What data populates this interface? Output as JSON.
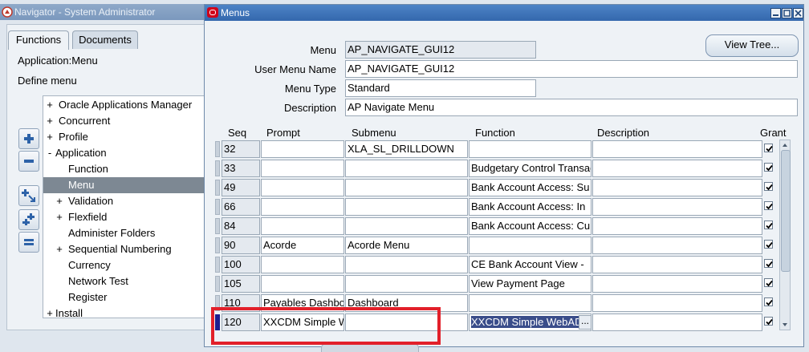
{
  "navigator": {
    "title": "Navigator - System Administrator",
    "tabs": [
      {
        "label": "Functions"
      },
      {
        "label": "Documents"
      }
    ],
    "application_label": "Application:Menu",
    "define_label": "Define menu",
    "tree": [
      {
        "expander": "+",
        "label": "Oracle Applications Manager"
      },
      {
        "expander": "+",
        "label": "Concurrent"
      },
      {
        "expander": "+",
        "label": "Profile"
      },
      {
        "expander": "-",
        "label": "Application"
      },
      {
        "expander": "",
        "label": "Function"
      },
      {
        "expander": "",
        "label": "Menu"
      },
      {
        "expander": "+",
        "label": "Validation"
      },
      {
        "expander": "+",
        "label": "Flexfield"
      },
      {
        "expander": "",
        "label": "Administer Folders"
      },
      {
        "expander": "+",
        "label": "Sequential Numbering"
      },
      {
        "expander": "",
        "label": "Currency"
      },
      {
        "expander": "",
        "label": "Network Test"
      },
      {
        "expander": "",
        "label": "Register"
      },
      {
        "expander": "+",
        "label": "Install"
      }
    ]
  },
  "menus_window": {
    "title": "Menus",
    "view_tree_label": "View Tree...",
    "fields": {
      "menu": {
        "label": "Menu",
        "value": "AP_NAVIGATE_GUI12"
      },
      "user_menu_name": {
        "label": "User Menu Name",
        "value": "AP_NAVIGATE_GUI12"
      },
      "menu_type": {
        "label": "Menu Type",
        "value": "Standard"
      },
      "description": {
        "label": "Description",
        "value": "AP Navigate Menu"
      }
    },
    "columns": {
      "seq": "Seq",
      "prompt": "Prompt",
      "submenu": "Submenu",
      "function": "Function",
      "description": "Description",
      "grant": "Grant"
    },
    "rows": [
      {
        "seq": "32",
        "prompt": "",
        "submenu": "XLA_SL_DRILLDOWN",
        "function": "",
        "description": "",
        "grant": true
      },
      {
        "seq": "33",
        "prompt": "",
        "submenu": "",
        "function": "Budgetary Control Transac",
        "description": "",
        "grant": true
      },
      {
        "seq": "49",
        "prompt": "",
        "submenu": "",
        "function": "Bank Account Access: Su",
        "description": "",
        "grant": true
      },
      {
        "seq": "66",
        "prompt": "",
        "submenu": "",
        "function": "Bank Account Access: In",
        "description": "",
        "grant": true
      },
      {
        "seq": "84",
        "prompt": "",
        "submenu": "",
        "function": "Bank Account Access: Cu",
        "description": "",
        "grant": true
      },
      {
        "seq": "90",
        "prompt": "Acorde",
        "submenu": "Acorde Menu",
        "function": "",
        "description": "",
        "grant": true
      },
      {
        "seq": "100",
        "prompt": "",
        "submenu": "",
        "function": "CE Bank Account View - ",
        "description": "",
        "grant": true
      },
      {
        "seq": "105",
        "prompt": "",
        "submenu": "",
        "function": "View Payment Page",
        "description": "",
        "grant": true
      },
      {
        "seq": "110",
        "prompt": "Payables Dashbo",
        "submenu": "Dashboard",
        "function": "",
        "description": "",
        "grant": true
      },
      {
        "seq": "120",
        "prompt": "XXCDM Simple W",
        "submenu": "",
        "function": "XXCDM Simple WebAD",
        "description": "",
        "grant": true
      }
    ],
    "lov_button_label": "...",
    "colors": {
      "titlebar": "#3468ad",
      "highlight_box": "#e2202a",
      "selected_text_bg": "#3a4d8a"
    }
  }
}
